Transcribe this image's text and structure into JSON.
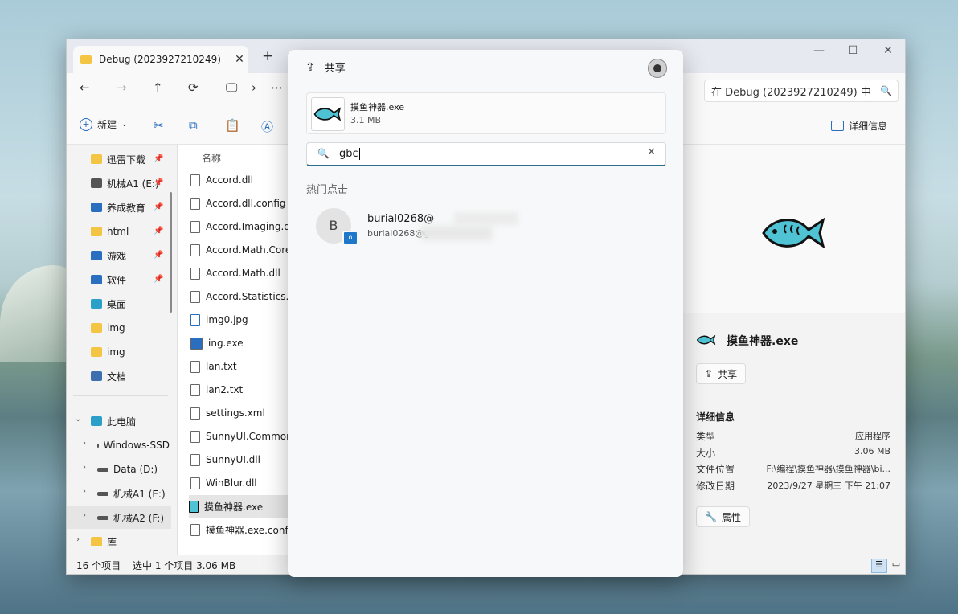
{
  "window": {
    "tab_title": "Debug (20239272102​49)",
    "search_placeholder": "在 Debug (2023927210249) 中"
  },
  "toolbar": {
    "new_label": "新建",
    "details_label": "详细信息"
  },
  "sidebar": {
    "quick": [
      {
        "label": "迅雷下载",
        "icon": "folder-icon",
        "color": "#f4c542"
      },
      {
        "label": "机械A1 (E:)",
        "icon": "drive-icon",
        "color": "#555555"
      },
      {
        "label": "养成教育",
        "icon": "monitor-icon",
        "color": "#2a6ebf"
      },
      {
        "label": "html",
        "icon": "folder-icon",
        "color": "#f4c542"
      },
      {
        "label": "游戏",
        "icon": "gamepad-icon",
        "color": "#2a6ebf"
      },
      {
        "label": "软件",
        "icon": "code-icon",
        "color": "#2a6ebf"
      },
      {
        "label": "桌面",
        "icon": "desktop-icon",
        "color": "#2aa0c9"
      },
      {
        "label": "img",
        "icon": "folder-icon",
        "color": "#f4c542"
      },
      {
        "label": "img",
        "icon": "folder-icon",
        "color": "#f4c542"
      },
      {
        "label": "文档",
        "icon": "document-icon",
        "color": "#3c6fb0"
      }
    ],
    "this_pc": "此电脑",
    "drives": [
      {
        "label": "Windows-SSD",
        "icon": "windows-icon"
      },
      {
        "label": "Data (D:)",
        "icon": "drive-icon"
      },
      {
        "label": "机械A1 (E:)",
        "icon": "drive-icon"
      },
      {
        "label": "机械A2 (F:)",
        "icon": "drive-icon"
      }
    ],
    "library": "库"
  },
  "files": {
    "column_name": "名称",
    "items": [
      "Accord.dll",
      "Accord.dll.config",
      "Accord.Imaging.dll",
      "Accord.Math.Core.dll",
      "Accord.Math.dll",
      "Accord.Statistics.dll",
      "img0.jpg",
      "ing.exe",
      "lan.txt",
      "lan2.txt",
      "settings.xml",
      "SunnyUI.Common.dll",
      "SunnyUI.dll",
      "WinBlur.dll",
      "摸鱼神器.exe",
      "摸鱼神器.exe.config"
    ],
    "selected_index": 14
  },
  "status": {
    "count": "16 个项目",
    "selected": "选中 1 个项目  3.06 MB"
  },
  "details": {
    "name": "摸鱼神器.exe",
    "share_label": "共享",
    "section": "详细信息",
    "rows": [
      {
        "k": "类型",
        "v": "应用程序"
      },
      {
        "k": "大小",
        "v": "3.06 MB"
      },
      {
        "k": "文件位置",
        "v": "F:\\编程\\摸鱼神器\\摸鱼神器\\bi..."
      },
      {
        "k": "修改日期",
        "v": "2023/9/27 星期三 下午 21:07"
      }
    ],
    "properties_label": "属性"
  },
  "share": {
    "title": "共享",
    "file_name": "摸鱼神器.exe",
    "file_size": "3.1 MB",
    "search_value": "gbc",
    "hot_label": "热门点击",
    "contact": {
      "initial": "B",
      "name": "burial0268@",
      "email": "burial0268@g"
    }
  },
  "colors": {
    "accent": "#2a6ebf",
    "fish_body": "#4fc3d4"
  }
}
